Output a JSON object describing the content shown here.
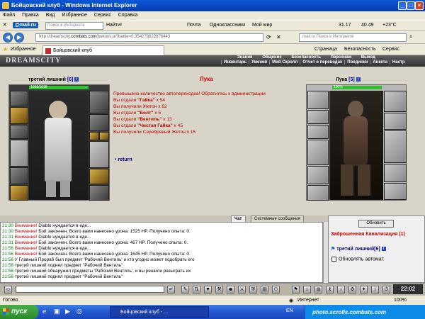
{
  "window": {
    "title": "Бойцовский клуб - Windows Internet Explorer"
  },
  "menu": [
    "Файл",
    "Правка",
    "Вид",
    "Избранное",
    "Сервис",
    "Справка"
  ],
  "toolbar": {
    "mail_label": "@mail.ru",
    "search_placeholder": "Поиск в Интернете",
    "find_label": "Найти!",
    "items": [
      "Почта",
      "Одноклассники",
      "Мой мир"
    ],
    "weather": "31.17",
    "rate": "40.49",
    "temp": "+23°C"
  },
  "address": {
    "url_prefix": "http://dreamscity.",
    "url_domain": "combats.com",
    "url_rest": "/buttons.pl?battle=0.354279822876443",
    "search_placeholder": "mail.ru Поиск в Интернете"
  },
  "favbar": {
    "favorites": "Избранное",
    "tab_title": "Бойцовский клуб",
    "right_items": [
      "Страница",
      "Безопасность",
      "Сервис"
    ]
  },
  "game": {
    "logo": "DREAMSCITY",
    "nav_top": [
      "Знания",
      "Общение",
      "Безопасность",
      "Персонаж",
      "Выход"
    ],
    "nav": [
      "Инвентарь",
      "Умения",
      "Мой Скролл",
      "Отчет о переводах",
      "Поединки",
      "Анкета",
      "Настр"
    ],
    "left_char": {
      "name": "третий лишний",
      "level": "[6]",
      "hp": "1098/1098"
    },
    "right_char": {
      "name": "Лука",
      "level": "[5]",
      "hp": "100%"
    },
    "battle_title": "Лука",
    "log": [
      {
        "pre": "Превышено количество автопереходов! Обратитесь к администрации",
        "bold": "",
        "post": ""
      },
      {
        "pre": "Вы отдали ",
        "bold": "\"Гайка\"",
        "post": " x 54"
      },
      {
        "pre": "Вы получили Жетон x 62",
        "bold": "",
        "post": ""
      },
      {
        "pre": "Вы отдали ",
        "bold": "\"Болт\"",
        "post": " x 5"
      },
      {
        "pre": "Вы отдали ",
        "bold": "\"Вентиль\"",
        "post": " x 13"
      },
      {
        "pre": "Вы отдали ",
        "bold": "\"Чистая Гайка\"",
        "post": " x 45"
      },
      {
        "pre": "Вы получили Серебряный Жетон x 15",
        "bold": "",
        "post": ""
      }
    ],
    "return_label": "return"
  },
  "chat": {
    "tabs": [
      "Чат",
      "Системные сообщения"
    ],
    "lines": [
      {
        "time": "21:30",
        "warn": "Внимание!",
        "text": " Diablo нуждается в еде..."
      },
      {
        "time": "21:30",
        "warn": "Внимание!",
        "text": " Бой закончен. Всего вами нанесено урона: 1525 HP. Получено опыта: 0."
      },
      {
        "time": "21:31",
        "warn": "Внимание!",
        "text": " Diablo нуждается в еде..."
      },
      {
        "time": "21:31",
        "warn": "Внимание!",
        "text": " Бой закончен. Всего вами нанесено урона: 467 HP. Получено опыта: 0."
      },
      {
        "time": "21:56",
        "warn": "Внимание!",
        "text": " Diablo нуждается в еде..."
      },
      {
        "time": "21:56",
        "warn": "Внимание!",
        "text": " Бой закончен. Всего вами нанесено урона: 1645 HP. Получено опыта: 0."
      },
      {
        "time": "21:56",
        "warn": "",
        "text": "У Главный Прораб был предмет 'Рабочий Вентиль' и кто угодно может подобрать его"
      },
      {
        "time": "21:56",
        "warn": "",
        "text": "третий лишний поднял предмет \"Рабочий Вентиль\""
      },
      {
        "time": "21:56",
        "warn": "",
        "text": "третий лишний обнаружил предметы 'Рабочий Вентиль', и вы решили разыграть их"
      },
      {
        "time": "21:56",
        "warn": "",
        "text": "третий лишний поднял предмет \"Рабочий Вентиль\""
      }
    ],
    "refresh_label": "Обновить",
    "location": "Заброшенная Канализация (1)",
    "player": "третий лишний[6]",
    "auto_update": "Обновлять автомат.",
    "clock": "22:02"
  },
  "status": {
    "left": "Готово",
    "zone": "Интернет",
    "zoom": "100%"
  },
  "taskbar": {
    "start": "пуск",
    "task": "Бойцовский клуб - ...",
    "lang": "EN",
    "watermark": "photo.scrolls.combats.com"
  }
}
